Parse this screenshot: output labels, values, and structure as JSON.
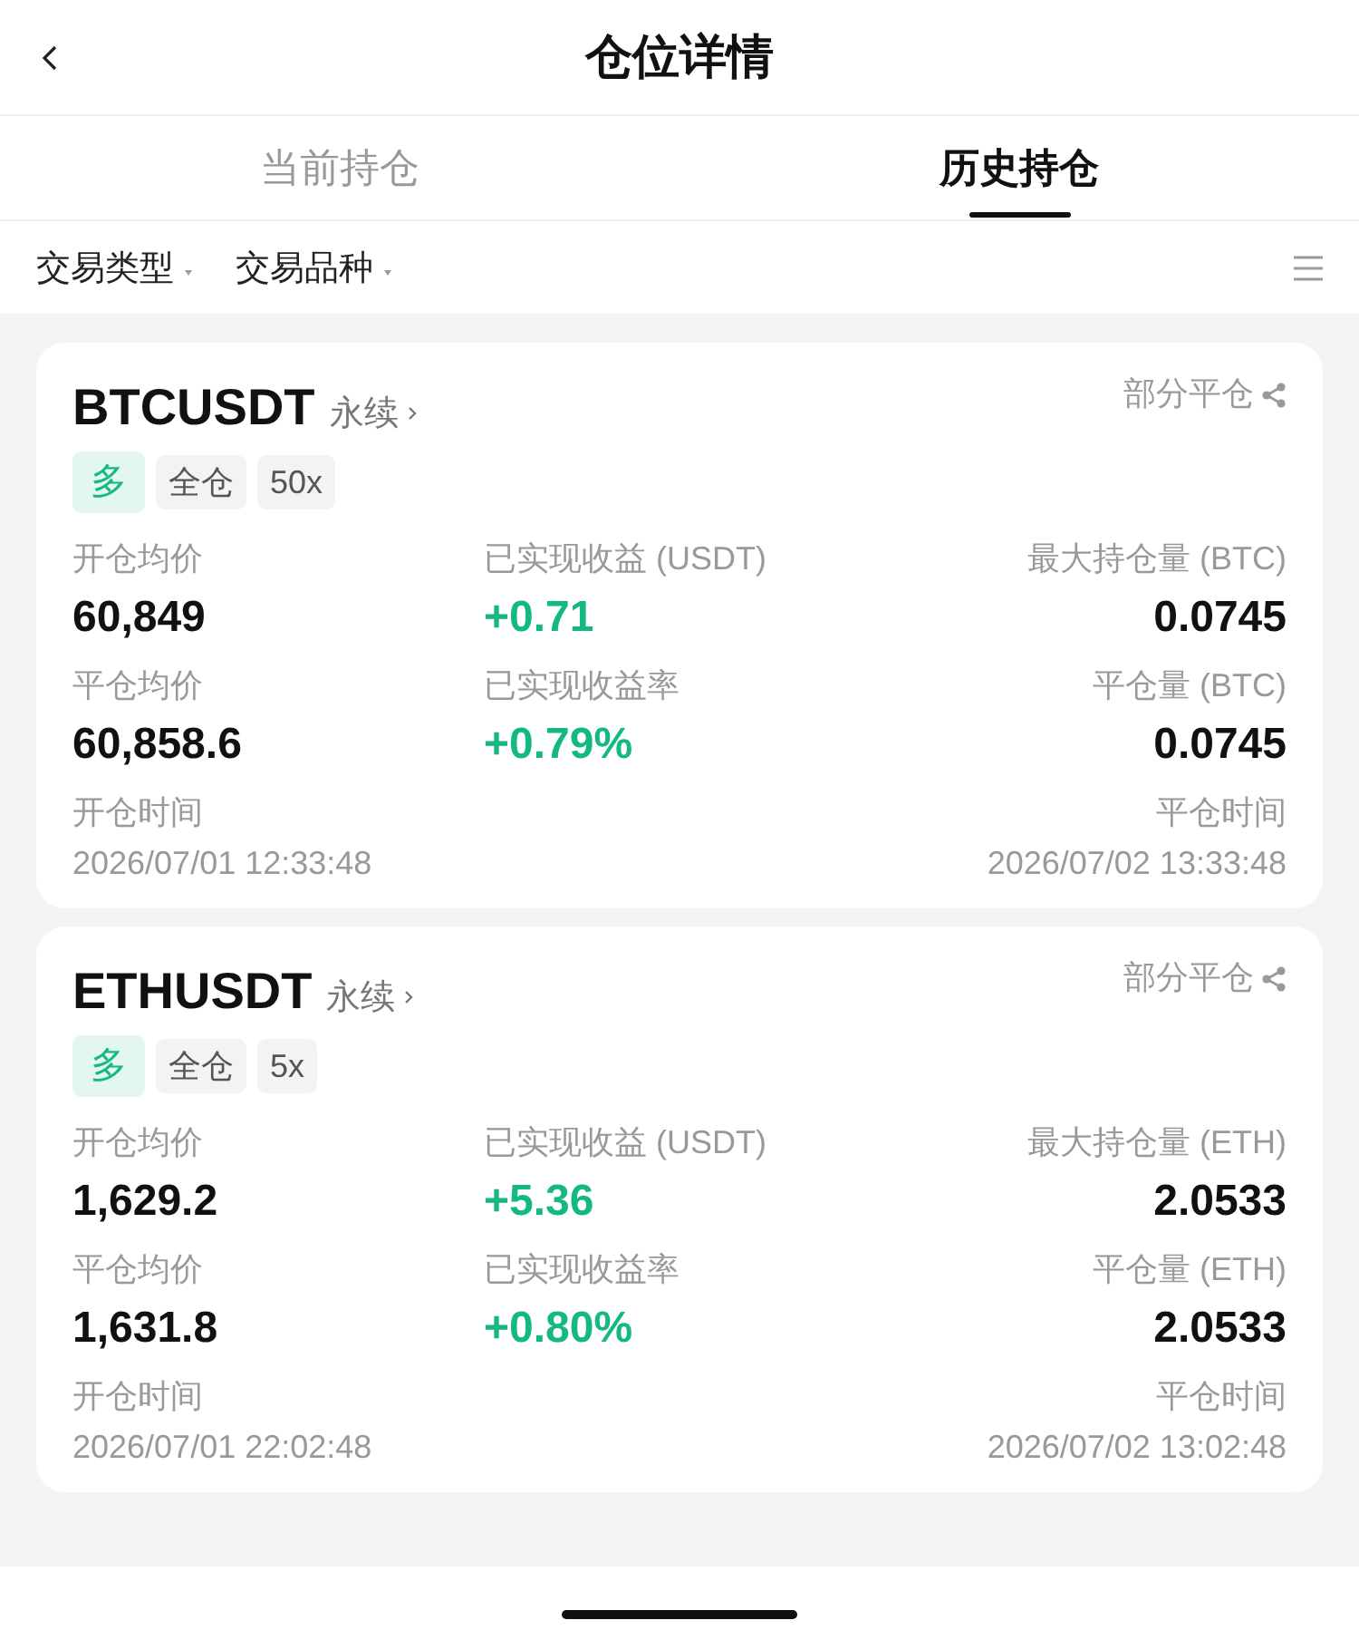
{
  "header": {
    "title": "仓位详情"
  },
  "tabs": [
    {
      "label": "当前持仓",
      "selected": false
    },
    {
      "label": "历史持仓",
      "selected": true
    }
  ],
  "filters": [
    {
      "label": "交易类型"
    },
    {
      "label": "交易品种"
    }
  ],
  "positions": [
    {
      "symbol": "BTCUSDT",
      "contract": "永续",
      "status": "部分平仓",
      "side": {
        "label": "多",
        "kind": "long"
      },
      "margin_mode": "全仓",
      "leverage": "50x",
      "metrics": [
        {
          "label": "开仓均价",
          "value": "60,849",
          "kind": "plain"
        },
        {
          "label": "已实现收益 (USDT)",
          "value": "+0.71",
          "kind": "profit"
        },
        {
          "label": "最大持仓量 (BTC)",
          "value": "0.0745",
          "kind": "plain"
        },
        {
          "label": "平仓均价",
          "value": "60,858.6",
          "kind": "plain"
        },
        {
          "label": "已实现收益率",
          "value": "+0.79%",
          "kind": "profit"
        },
        {
          "label": "平仓量 (BTC)",
          "value": "0.0745",
          "kind": "plain"
        }
      ],
      "open_time": {
        "label": "开仓时间",
        "value": "2026/07/01 12:33:48"
      },
      "close_time": {
        "label": "平仓时间",
        "value": "2026/07/02 13:33:48"
      }
    },
    {
      "symbol": "ETHUSDT",
      "contract": "永续",
      "status": "部分平仓",
      "side": {
        "label": "多",
        "kind": "long"
      },
      "margin_mode": "全仓",
      "leverage": "5x",
      "metrics": [
        {
          "label": "开仓均价",
          "value": "1,629.2",
          "kind": "plain"
        },
        {
          "label": "已实现收益 (USDT)",
          "value": "+5.36",
          "kind": "profit"
        },
        {
          "label": "最大持仓量 (ETH)",
          "value": "2.0533",
          "kind": "plain"
        },
        {
          "label": "平仓均价",
          "value": "1,631.8",
          "kind": "plain"
        },
        {
          "label": "已实现收益率",
          "value": "+0.80%",
          "kind": "profit"
        },
        {
          "label": "平仓量 (ETH)",
          "value": "2.0533",
          "kind": "plain"
        }
      ],
      "open_time": {
        "label": "开仓时间",
        "value": "2026/07/01 22:02:48"
      },
      "close_time": {
        "label": "平仓时间",
        "value": "2026/07/02 13:02:48"
      }
    }
  ]
}
